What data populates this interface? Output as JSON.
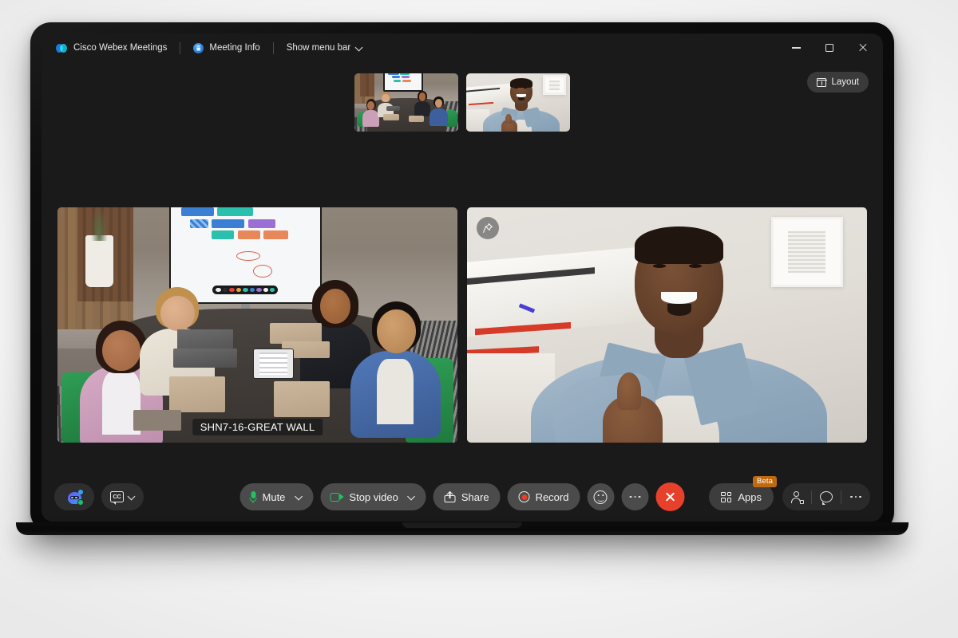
{
  "app": {
    "title": "Cisco Webex Meetings",
    "meeting_info_label": "Meeting Info",
    "show_menu_bar_label": "Show menu bar",
    "logo_icon": "webex-logo-icon",
    "info_icon": "meeting-info-icon",
    "menu_chevron_icon": "chevron-down-icon"
  },
  "window_controls": {
    "minimize": "minimize-icon",
    "maximize": "maximize-icon",
    "close": "close-icon"
  },
  "stage": {
    "layout_button": {
      "label": "Layout",
      "icon": "layout-grid-icon"
    },
    "filmstrip": [
      {
        "name": "thumbnail-conference-room",
        "alt": "Conference room with four participants"
      },
      {
        "name": "thumbnail-remote-participant",
        "alt": "Remote participant giving thumbs up"
      }
    ],
    "tiles": [
      {
        "name": "conference-room-tile",
        "label": "SHN7-16-GREAT WALL",
        "has_label": true
      },
      {
        "name": "remote-participant-tile",
        "label": "",
        "has_label": false,
        "pin_icon": "pin-icon"
      }
    ]
  },
  "toolbar": {
    "left": [
      {
        "name": "ai-assistant-button",
        "icon": "ai-assistant-icon",
        "label": ""
      },
      {
        "name": "closed-captions-button",
        "icon": "closed-captions-icon",
        "cc_text": "CC",
        "chevron": "chevron-down-icon"
      }
    ],
    "center": {
      "mute": {
        "label": "Mute",
        "icon": "microphone-icon",
        "chevron": "chevron-down-icon"
      },
      "video": {
        "label": "Stop video",
        "icon": "camera-icon",
        "chevron": "chevron-down-icon"
      },
      "share": {
        "label": "Share",
        "icon": "share-screen-icon"
      },
      "record": {
        "label": "Record",
        "icon": "record-icon"
      },
      "reactions": {
        "label": "",
        "icon": "reactions-smiley-icon"
      },
      "more": {
        "label": "",
        "icon": "more-horizontal-icon"
      },
      "end": {
        "label": "",
        "icon": "end-call-icon"
      }
    },
    "right": {
      "apps": {
        "label": "Apps",
        "icon": "apps-grid-icon",
        "badge": "Beta"
      },
      "participants": {
        "icon": "participants-icon"
      },
      "chat": {
        "icon": "chat-bubble-icon"
      },
      "more": {
        "icon": "more-horizontal-icon"
      }
    }
  },
  "colors": {
    "accent_green": "#1ec45f",
    "record_red": "#e8412b",
    "end_call_red": "#e8412b",
    "beta_orange": "#c06a10",
    "app_background": "#1a1a1a",
    "pill_background": "#4b4b4b"
  }
}
